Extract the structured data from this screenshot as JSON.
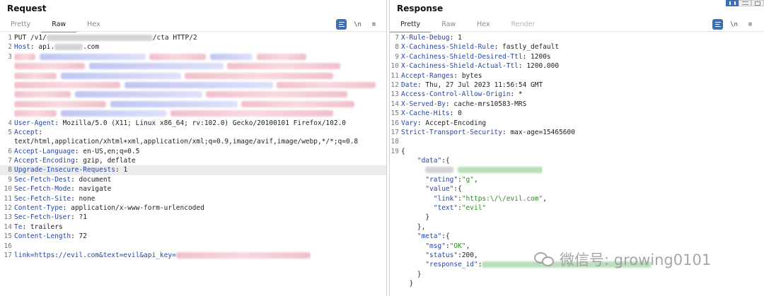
{
  "request": {
    "title": "Request",
    "tabs": [
      "Pretty",
      "Raw",
      "Hex"
    ],
    "active_tab": "Raw",
    "tool_newline": "\\n",
    "tool_menu": "≡",
    "lines": [
      {
        "n": "1",
        "text": "PUT /v1/",
        "redact_after": "gray",
        "tail": "/cta HTTP/2"
      },
      {
        "n": "2",
        "key": "Host",
        "value": " api.",
        "tail": ".com"
      },
      {
        "n": "3",
        "redacted": true
      },
      {
        "n": "",
        "redacted": true
      },
      {
        "n": "",
        "redacted": true
      },
      {
        "n": "",
        "redacted": true
      },
      {
        "n": "",
        "redacted": true
      },
      {
        "n": "",
        "redacted": true
      },
      {
        "n": "",
        "redacted": true
      },
      {
        "n": "4",
        "key": "User-Agent",
        "value": " Mozilla/5.0 (X11; Linux x86_64; rv:102.0) Gecko/20100101 Firefox/102.0"
      },
      {
        "n": "5",
        "key": "Accept",
        "value": ""
      },
      {
        "n": "",
        "value": "text/html,application/xhtml+xml,application/xml;q=0.9,image/avif,image/webp,*/*;q=0.8"
      },
      {
        "n": "6",
        "key": "Accept-Language",
        "value": " en-US,en;q=0.5"
      },
      {
        "n": "7",
        "key": "Accept-Encoding",
        "value": " gzip, deflate"
      },
      {
        "n": "8",
        "key": "Upgrade-Insecure-Requests",
        "value": " 1",
        "highlight": true
      },
      {
        "n": "9",
        "key": "Sec-Fetch-Dest",
        "value": " document"
      },
      {
        "n": "10",
        "key": "Sec-Fetch-Mode",
        "value": " navigate"
      },
      {
        "n": "11",
        "key": "Sec-Fetch-Site",
        "value": " none"
      },
      {
        "n": "12",
        "key": "Content-Type",
        "value": " application/x-www-form-urlencoded"
      },
      {
        "n": "13",
        "key": "Sec-Fetch-User",
        "value": " ?1"
      },
      {
        "n": "14",
        "key": "Te",
        "value": " trailers"
      },
      {
        "n": "15",
        "key": "Content-Length",
        "value": " 72"
      },
      {
        "n": "16",
        "value": ""
      },
      {
        "n": "17",
        "body": "link=https://evil.com&text=evil&api_key="
      }
    ]
  },
  "response": {
    "title": "Response",
    "tabs": [
      "Pretty",
      "Raw",
      "Hex",
      "Render"
    ],
    "active_tab": "Pretty",
    "tool_newline": "\\n",
    "tool_menu": "≡",
    "lines": [
      {
        "n": "7",
        "key": "X-Rule-Debug",
        "value": " 1"
      },
      {
        "n": "8",
        "key": "X-Cachiness-Shield-Rule",
        "value": " fastly_default"
      },
      {
        "n": "9",
        "key": "X-Cachiness-Shield-Desired-Ttl",
        "value": " 1200s"
      },
      {
        "n": "10",
        "key": "X-Cachiness-Shield-Actual-Ttl",
        "value": " 1200.000"
      },
      {
        "n": "11",
        "key": "Accept-Ranges",
        "value": " bytes"
      },
      {
        "n": "12",
        "key": "Date",
        "value": " Thu, 27 Jul 2023 11:56:54 GMT"
      },
      {
        "n": "13",
        "key": "Access-Control-Allow-Origin",
        "value": " *"
      },
      {
        "n": "14",
        "key": "X-Served-By",
        "value": " cache-mrs10583-MRS"
      },
      {
        "n": "15",
        "key": "X-Cache-Hits",
        "value": " 0"
      },
      {
        "n": "16",
        "key": "Vary",
        "value": " Accept-Encoding"
      },
      {
        "n": "17",
        "key": "Strict-Transport-Security",
        "value": " max-age=15465600"
      },
      {
        "n": "18",
        "value": ""
      },
      {
        "n": "19",
        "json": "{"
      }
    ],
    "json_lines": [
      {
        "indent": "  ",
        "jk": "\"data\"",
        "p": ":{"
      },
      {
        "indent": "    ",
        "redacted": true
      },
      {
        "indent": "    ",
        "jk": "\"rating\"",
        "p": ":",
        "js": "\"g\"",
        "p2": ","
      },
      {
        "indent": "    ",
        "jk": "\"value\"",
        "p": ":{"
      },
      {
        "indent": "      ",
        "jk": "\"link\"",
        "p": ":",
        "js": "\"https:\\/\\/evil.com\"",
        "p2": ","
      },
      {
        "indent": "      ",
        "jk": "\"text\"",
        "p": ":",
        "js": "\"evil\""
      },
      {
        "indent": "    ",
        "p": "}"
      },
      {
        "indent": "  ",
        "p": "},"
      },
      {
        "indent": "  ",
        "jk": "\"meta\"",
        "p": ":{"
      },
      {
        "indent": "    ",
        "jk": "\"msg\"",
        "p": ":",
        "js": "\"OK\"",
        "p2": ","
      },
      {
        "indent": "    ",
        "jk": "\"status\"",
        "p": ":",
        "jn": "200",
        "p2": ","
      },
      {
        "indent": "    ",
        "jk": "\"response_id\"",
        "p": ":",
        "redacted_green": true
      },
      {
        "indent": "  ",
        "p": "}"
      },
      {
        "indent": "",
        "p": "}"
      }
    ]
  },
  "watermark": "微信号: growing0101"
}
